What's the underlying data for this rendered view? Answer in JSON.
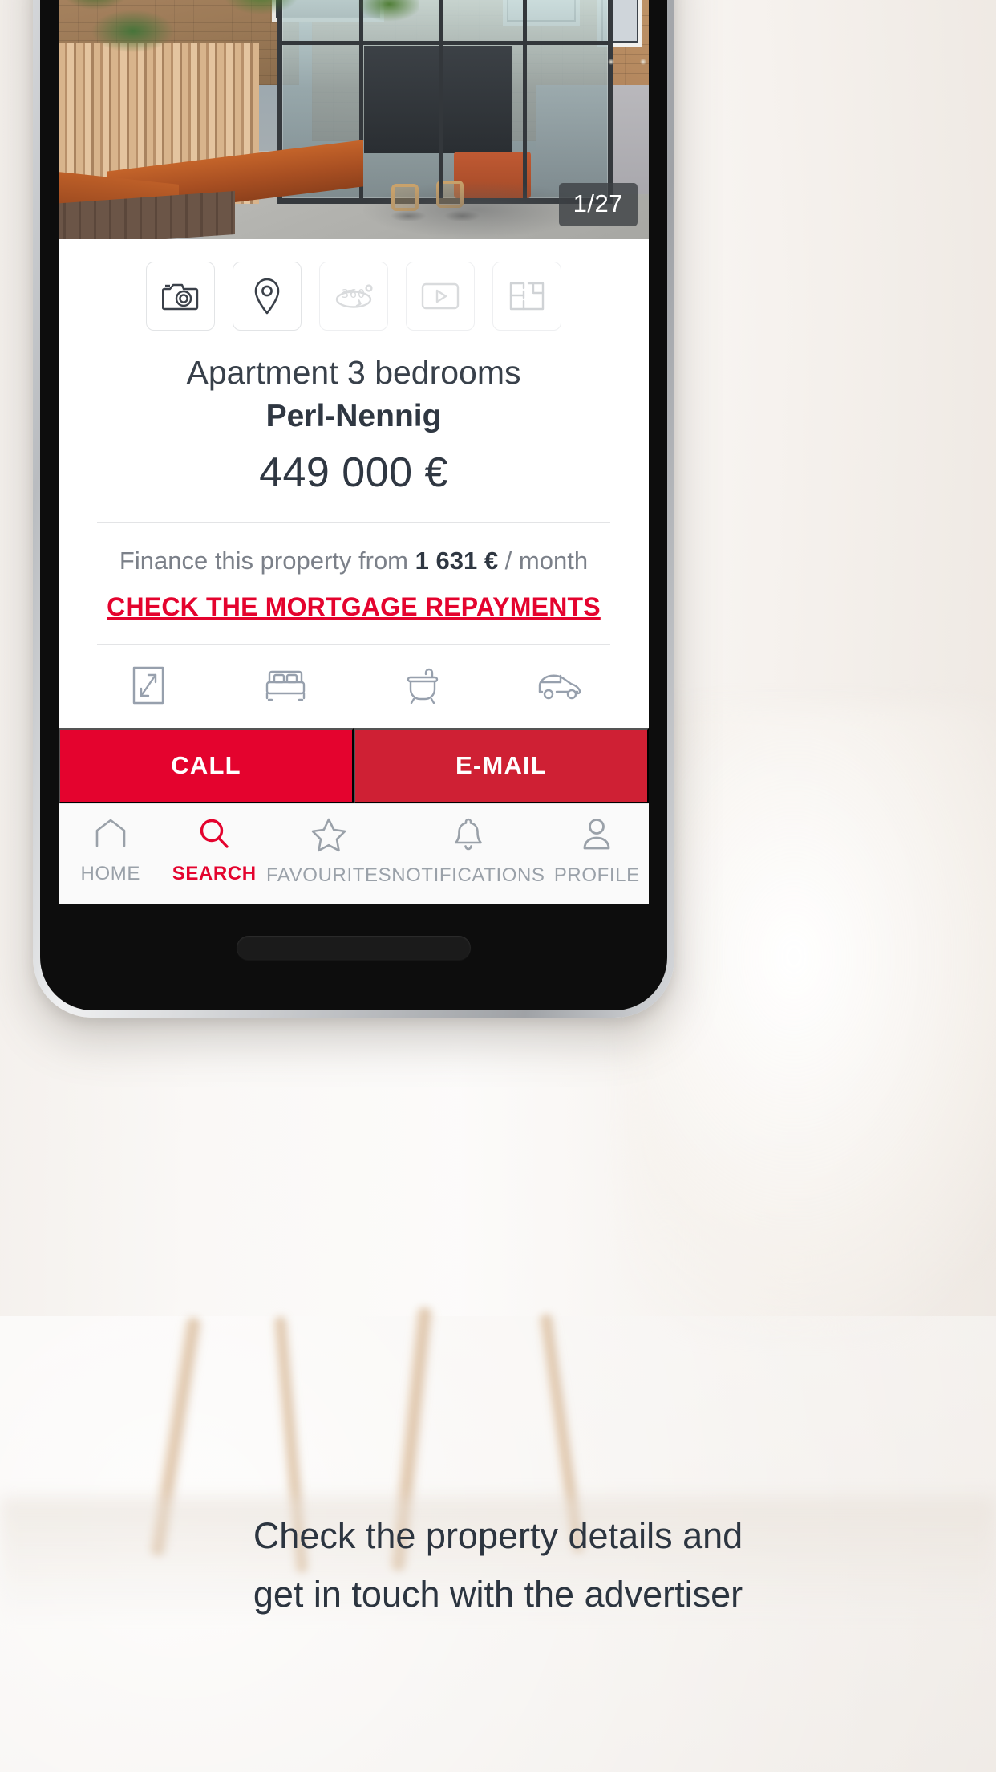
{
  "app": {
    "accent_red": "#e4032e",
    "accent_red_dark": "#cf2034",
    "text_dark": "#2f3742",
    "text_muted": "#7b8089",
    "icon_grey": "#9aa1a9"
  },
  "hero": {
    "photo_counter": "1/27",
    "photo_alt": "Garden terrace with glass extension"
  },
  "media_chips": [
    {
      "icon": "camera-icon",
      "name": "photos",
      "enabled": true
    },
    {
      "icon": "map-pin-icon",
      "name": "map",
      "enabled": true
    },
    {
      "icon": "360-icon",
      "name": "virtual-tour",
      "enabled": false
    },
    {
      "icon": "video-play-icon",
      "name": "video",
      "enabled": false
    },
    {
      "icon": "floor-plan-icon",
      "name": "floor-plan",
      "enabled": false
    }
  ],
  "listing": {
    "title": "Apartment 3 bedrooms",
    "city": "Perl-Nennig",
    "price": "449 000 €"
  },
  "finance": {
    "prefix": "Finance this property from ",
    "amount": "1 631 €",
    "suffix": " / month",
    "cta_label": "CHECK THE MORTGAGE REPAYMENTS"
  },
  "features": [
    {
      "icon": "surface-area-icon",
      "name": "surface-area"
    },
    {
      "icon": "bed-icon",
      "name": "bedrooms"
    },
    {
      "icon": "bathtub-icon",
      "name": "bathrooms"
    },
    {
      "icon": "car-icon",
      "name": "parking"
    }
  ],
  "actions": {
    "call_label": "CALL",
    "email_label": "E-MAIL"
  },
  "bottom_nav": {
    "items": [
      {
        "label": "HOME",
        "icon": "home-icon",
        "active": false
      },
      {
        "label": "SEARCH",
        "icon": "search-icon",
        "active": true
      },
      {
        "label": "FAVOURITES",
        "icon": "star-icon",
        "active": false
      },
      {
        "label": "NOTIFICATIONS",
        "icon": "bell-icon",
        "active": false
      },
      {
        "label": "PROFILE",
        "icon": "person-icon",
        "active": false
      }
    ]
  },
  "caption": {
    "line1": "Check the property details and",
    "line2": "get in touch with the advertiser"
  }
}
